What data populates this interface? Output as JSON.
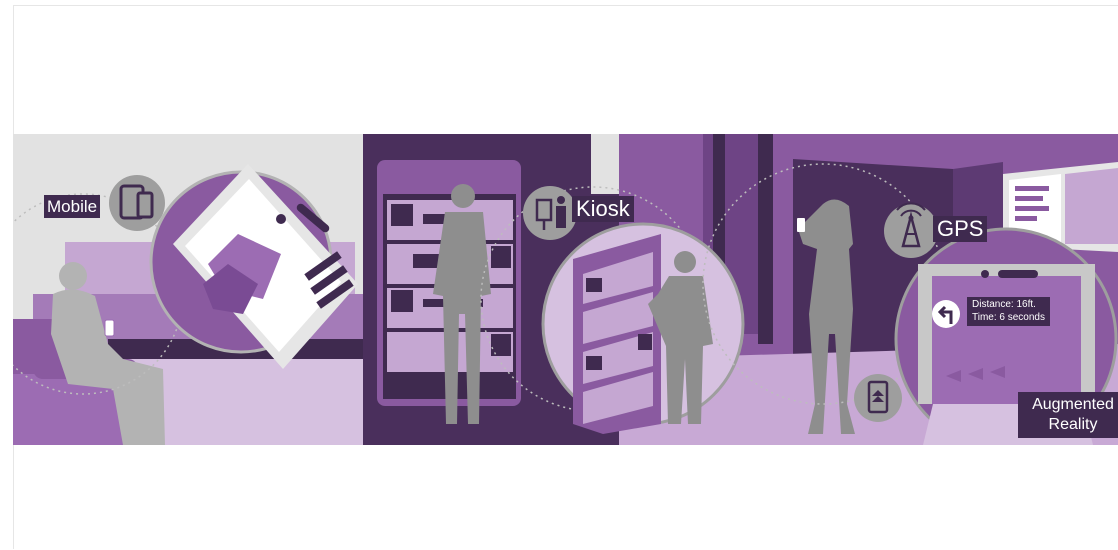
{
  "labels": {
    "mobile": "Mobile",
    "kiosk": "Kiosk",
    "gps": "GPS",
    "augmented_reality": "Augmented Reality"
  },
  "ar_overlay": {
    "distance": "Distance: 16ft.",
    "time": "Time: 6 seconds"
  },
  "icons": [
    "tablet-phone-icon",
    "kiosk-person-icon",
    "gps-tower-icon",
    "phone-ar-icon",
    "coffee-icon",
    "shopping-bag-icon",
    "map-pin-icon",
    "globe-icon",
    "turn-left-arrow-icon"
  ],
  "colors": {
    "dark_purple": "#3f2a4f",
    "purple": "#8a5aa0",
    "mid_purple": "#9c6cb3",
    "light_purple": "#c9a9d6",
    "lavender": "#d9c3e2",
    "gray_figure": "#9e9e9e",
    "background_gray": "#e4e4e4"
  }
}
